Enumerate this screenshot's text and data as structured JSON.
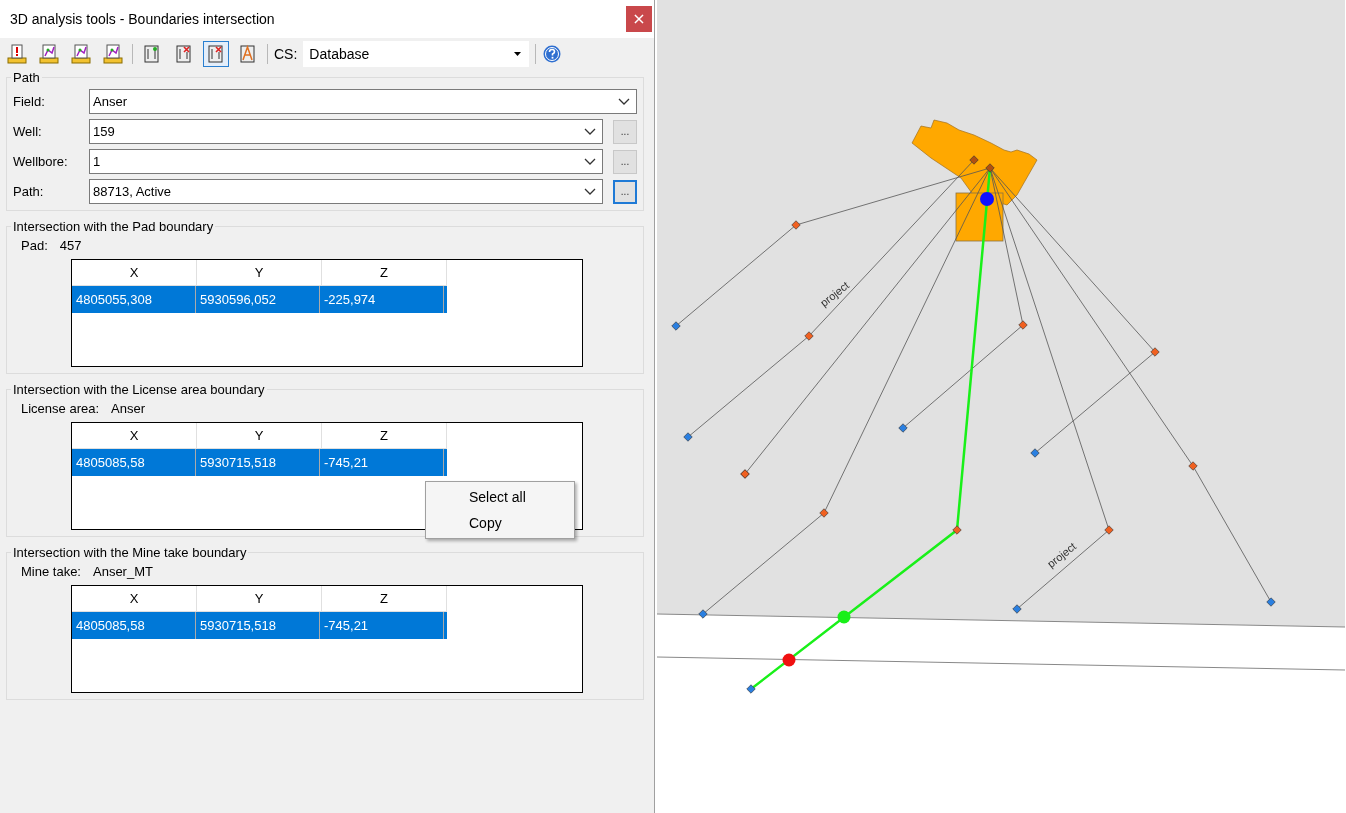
{
  "window": {
    "title": "3D analysis tools - Boundaries intersection",
    "close": "×"
  },
  "toolbar": {
    "buttons": [
      {
        "kind": "ruler-alert",
        "selected": false
      },
      {
        "kind": "ruler-graph",
        "selected": false
      },
      {
        "kind": "ruler-graph",
        "selected": false
      },
      {
        "kind": "ruler-graph",
        "selected": false
      },
      {
        "kind": "page",
        "selected": false
      },
      {
        "kind": "page-cross",
        "selected": false
      },
      {
        "kind": "page-cross",
        "selected": true
      },
      {
        "kind": "page-letter",
        "selected": false
      }
    ],
    "cs_label": "CS:",
    "cs_value": "Database"
  },
  "path_group": {
    "title": "Path",
    "fields": [
      {
        "label": "Field:",
        "value": "Anser"
      },
      {
        "label": "Well:",
        "value": "159",
        "browse": {
          "label": "...",
          "focused": false
        }
      },
      {
        "label": "Wellbore:",
        "value": "1",
        "browse": {
          "label": "...",
          "focused": false
        }
      },
      {
        "label": "Path:",
        "value": "88713, Active",
        "browse": {
          "label": "...",
          "focused": true
        }
      }
    ]
  },
  "intersections": [
    {
      "title": "Intersection with the Pad boundary",
      "info_label": "Pad:",
      "info_value": "457",
      "columns": [
        "X",
        "Y",
        "Z"
      ],
      "rows": [
        {
          "cells": [
            "4805055,308",
            "5930596,052",
            "-225,974"
          ],
          "selected": true
        }
      ]
    },
    {
      "title": "Intersection with the License area boundary",
      "info_label": "License area:",
      "info_value": "Anser",
      "columns": [
        "X",
        "Y",
        "Z"
      ],
      "rows": [
        {
          "cells": [
            "4805085,58",
            "5930715,518",
            "-745,21"
          ],
          "selected": true
        }
      ],
      "context_menu": [
        "Select all",
        "Copy"
      ]
    },
    {
      "title": "Intersection with the Mine take boundary",
      "info_label": "Mine take:",
      "info_value": "Anser_MT",
      "columns": [
        "X",
        "Y",
        "Z"
      ],
      "rows": [
        {
          "cells": [
            "4805085,58",
            "5930715,518",
            "-745,21"
          ],
          "selected": true
        }
      ]
    }
  ],
  "map": {
    "labels": [
      "project",
      "project"
    ]
  }
}
